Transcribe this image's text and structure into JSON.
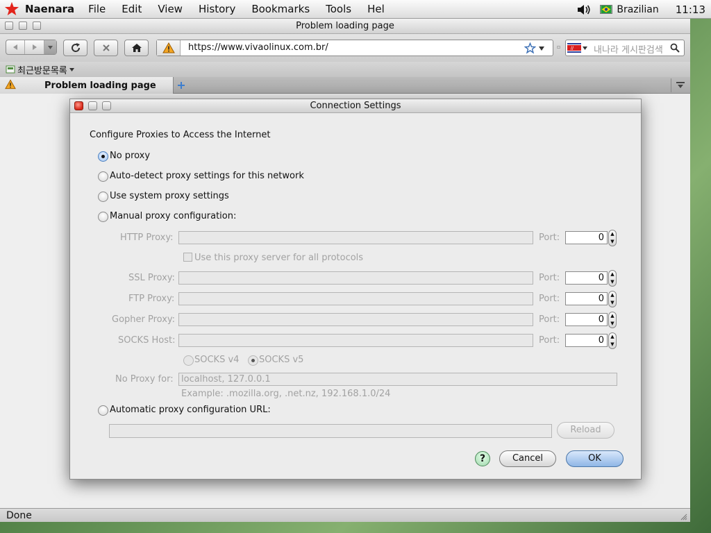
{
  "menubar": {
    "app_name": "Naenara",
    "items": [
      "File",
      "Edit",
      "View",
      "History",
      "Bookmarks",
      "Tools",
      "Hel"
    ],
    "input_source": "Brazilian",
    "clock": "11:13",
    "colors": {
      "star": "#e3241b"
    }
  },
  "browser": {
    "window_title": "Problem loading page",
    "url": "https://www.vivaolinux.com.br/",
    "search_placeholder": "내나라 게시판검색",
    "bookmarks_menu": "최근방문목록",
    "tab_title": "Problem loading page",
    "status": "Done"
  },
  "dialog": {
    "title": "Connection Settings",
    "heading": "Configure Proxies to Access the Internet",
    "options": {
      "no_proxy": "No proxy",
      "auto_detect": "Auto-detect proxy settings for this network",
      "system": "Use system proxy settings",
      "manual": "Manual proxy configuration:",
      "auto_url": "Automatic proxy configuration URL:"
    },
    "selected_option": "no_proxy",
    "http_label": "HTTP Proxy:",
    "ssl_label": "SSL Proxy:",
    "ftp_label": "FTP Proxy:",
    "gopher_label": "Gopher Proxy:",
    "socks_label": "SOCKS Host:",
    "port_label": "Port:",
    "ports": {
      "http": "0",
      "ssl": "0",
      "ftp": "0",
      "gopher": "0",
      "socks": "0"
    },
    "use_for_all": "Use this proxy server for all protocols",
    "socks_v4": "SOCKS v4",
    "socks_v5": "SOCKS v5",
    "no_proxy_label": "No Proxy for:",
    "no_proxy_value": "localhost, 127.0.0.1",
    "example": "Example: .mozilla.org, .net.nz, 192.168.1.0/24",
    "reload": "Reload",
    "help": "?",
    "cancel": "Cancel",
    "ok": "OK"
  }
}
